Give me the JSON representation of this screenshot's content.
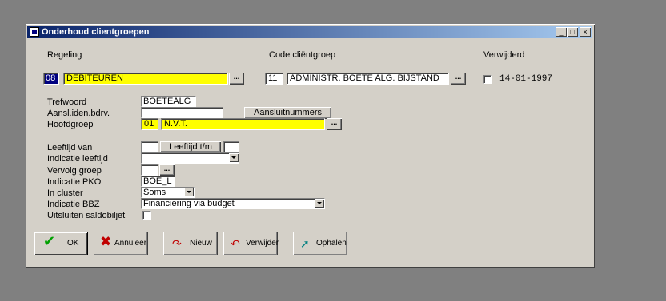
{
  "window": {
    "title": "Onderhoud clientgroepen",
    "minimize": "_",
    "maximize": "□",
    "close": "×"
  },
  "headers": {
    "regeling": "Regeling",
    "code": "Code cliëntgroep",
    "verwijderd": "Verwijderd"
  },
  "row1": {
    "regeling_code": "08",
    "regeling_name": "DEBITEUREN",
    "code_num": "11",
    "code_name": "ADMINISTR. BOETE ALG. BIJSTAND",
    "verwijderd_date": "14-01-1997",
    "ellipsis": "..."
  },
  "labels": {
    "trefwoord": "Trefwoord",
    "aansl": "Aansl.iden.bdrv.",
    "hoofdgroep": "Hoofdgroep",
    "leeftijd_van": "Leeftijd van",
    "indicatie_leeftijd": "Indicatie leeftijd",
    "vervolg_groep": "Vervolg groep",
    "indicatie_pko": "Indicatie PKO",
    "in_cluster": "In cluster",
    "indicatie_bbz": "Indicatie BBZ",
    "uitsluiten": "Uitsluiten saldobiljet"
  },
  "fields": {
    "trefwoord": "BOETEALG",
    "aansl": "",
    "aansluitnummers_button": "Aansluitnummers",
    "hoofdgroep_code": "01",
    "hoofdgroep_name": "N.V.T.",
    "leeftijd_van": "",
    "leeftijd_tm_button": "Leeftijd t/m",
    "leeftijd_tm": "",
    "indicatie_leeftijd": "",
    "vervolg_groep": "",
    "indicatie_pko": "BOE_L",
    "in_cluster": "Soms",
    "indicatie_bbz": "Financiering via budget"
  },
  "buttons": {
    "ok": "OK",
    "annuleer": "Annuleer",
    "nieuw": "Nieuw",
    "verwijder": "Verwijder",
    "ophalen": "Ophalen"
  },
  "colors": {
    "titlebar": "#0a246a",
    "highlight": "#ffff00",
    "face": "#d4d0c8",
    "code_badge": "#000080"
  },
  "icons": {
    "ok": "checkmark-icon",
    "annuleer": "x-cross-icon",
    "nieuw": "new-arrow-icon",
    "verwijder": "delete-arrow-icon",
    "ophalen": "retrieve-icon"
  }
}
